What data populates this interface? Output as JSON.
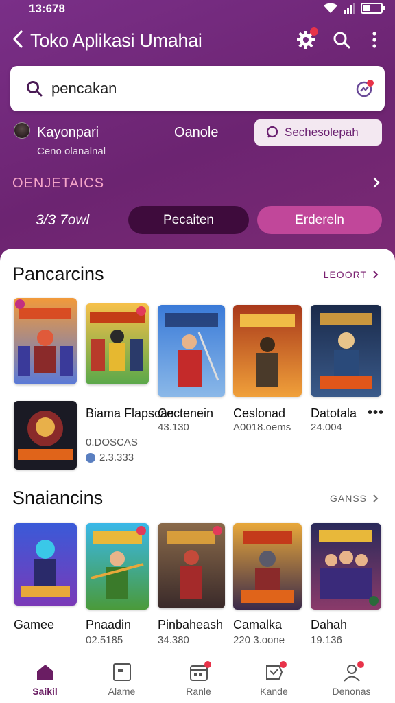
{
  "status_bar": {
    "time": "13:678"
  },
  "header": {
    "title": "Toko Aplikasi Umahai",
    "search": {
      "value": "pencakan"
    }
  },
  "user": {
    "name": "Kayonpari",
    "subtitle": "Ceno olanalnal",
    "middle_label": "Oanole",
    "suggest_button": "Sechesolepah"
  },
  "section_label": "OENJETAICS",
  "filters": {
    "text": "3/3 7owl",
    "primary": "Pecaiten",
    "secondary": "Erdereln"
  },
  "sections": [
    {
      "title": "Pancarcins",
      "more": "LEOORT",
      "apps": [
        {
          "name": "Biama Flapscan",
          "meta": "0.DOSCAS",
          "rating": "2.3.333"
        },
        {
          "name": "Cectenein",
          "meta": "43.130"
        },
        {
          "name": "Ceslonad",
          "meta": "A0018.oems"
        },
        {
          "name": "Datotala",
          "meta": "24.004"
        }
      ]
    },
    {
      "title": "Snaiancins",
      "more": "GANSS",
      "apps": [
        {
          "name": "Gamee",
          "meta": ""
        },
        {
          "name": "Pnaadin",
          "meta": "02.5185"
        },
        {
          "name": "Pinbaheash",
          "meta": "34.380"
        },
        {
          "name": "Camalka",
          "meta": "220 3.oone"
        },
        {
          "name": "Dahah",
          "meta": "19.136"
        }
      ]
    }
  ],
  "bottom_nav": [
    {
      "label": "Saikil",
      "icon": "home-icon",
      "active": true
    },
    {
      "label": "Alame",
      "icon": "apps-icon",
      "active": false
    },
    {
      "label": "Ranle",
      "icon": "calendar-icon",
      "active": false
    },
    {
      "label": "Kande",
      "icon": "ticket-icon",
      "active": false
    },
    {
      "label": "Denonas",
      "icon": "profile-icon",
      "active": false
    }
  ],
  "colors": {
    "accent": "#6a1d63",
    "hero": "#72287e",
    "pill_dark": "#3e0b3c",
    "pill_pink": "#c1479a"
  }
}
